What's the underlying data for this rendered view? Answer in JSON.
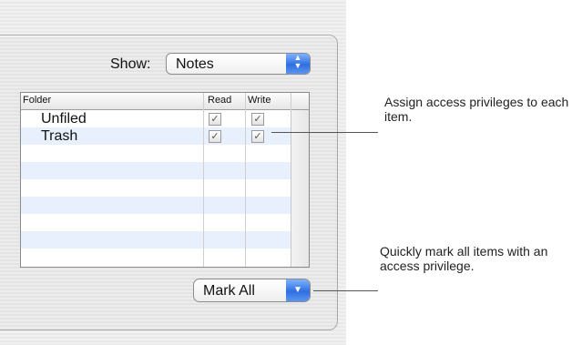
{
  "show": {
    "label": "Show:",
    "selected": "Notes"
  },
  "table": {
    "headers": {
      "folder": "Folder",
      "read": "Read",
      "write": "Write"
    },
    "rows": [
      {
        "name": "Unfiled",
        "read": true,
        "write": true
      },
      {
        "name": "Trash",
        "read": true,
        "write": true
      }
    ]
  },
  "mark_all": {
    "label": "Mark All"
  },
  "callouts": {
    "assign": "Assign access privileges to each item.",
    "quick": "Quickly mark all items with an access privilege."
  },
  "colors": {
    "accent": "#2f6fe0",
    "row_alt": "#e8f0fd"
  }
}
